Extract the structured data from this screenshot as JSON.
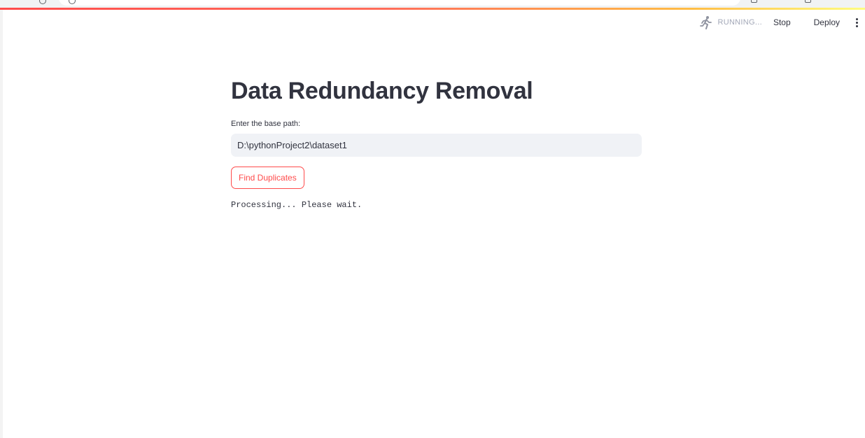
{
  "app": {
    "title": "Data Redundancy Removal"
  },
  "toolbar": {
    "status_label": "RUNNING...",
    "status_icon": "running-man-icon",
    "stop_label": "Stop",
    "deploy_label": "Deploy",
    "menu_icon": "vertical-ellipsis-icon"
  },
  "form": {
    "path_label": "Enter the base path:",
    "path_value": "D:\\pythonProject2\\dataset1",
    "button_label": "Find Duplicates"
  },
  "output": {
    "message": "Processing... Please wait."
  },
  "colors": {
    "accent": "#ff4b4b",
    "text": "#31333f",
    "input_bg": "#f0f2f6",
    "status_text": "#a3a8b8"
  }
}
